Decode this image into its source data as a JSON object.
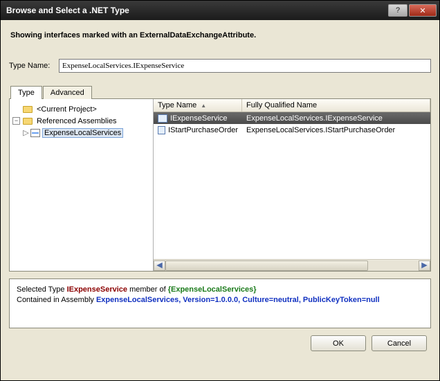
{
  "window": {
    "title": "Browse and Select a .NET Type",
    "help_symbol": "?",
    "close_symbol": "✕"
  },
  "heading": "Showing interfaces marked with an ExternalDataExchangeAttribute.",
  "typeName": {
    "label": "Type Name:",
    "value": "ExpenseLocalServices.IExpenseService"
  },
  "tabs": {
    "type": "Type",
    "advanced": "Advanced"
  },
  "tree": {
    "currentProject": "<Current Project>",
    "referenced": "Referenced Assemblies",
    "expense": "ExpenseLocalServices",
    "expander_minus": "−",
    "triangle": "▷"
  },
  "list": {
    "col_typeName": "Type Name",
    "col_fullyQualified": "Fully Qualified Name",
    "sort_glyph": "▲",
    "rows": [
      {
        "name": "IExpenseService",
        "fqn": "ExpenseLocalServices.IExpenseService"
      },
      {
        "name": "IStartPurchaseOrder",
        "fqn": "ExpenseLocalServices.IStartPurchaseOrder"
      }
    ]
  },
  "scroll": {
    "left": "◀",
    "right": "▶"
  },
  "info": {
    "t1a": "Selected Type ",
    "t1b": "IExpenseService",
    "t1c": " member of ",
    "t1d": "{ExpenseLocalServices}",
    "t2a": "Contained in Assembly ",
    "t2b": "ExpenseLocalServices, Version=1.0.0.0, Culture=neutral, PublicKeyToken=null"
  },
  "buttons": {
    "ok": "OK",
    "cancel": "Cancel"
  }
}
